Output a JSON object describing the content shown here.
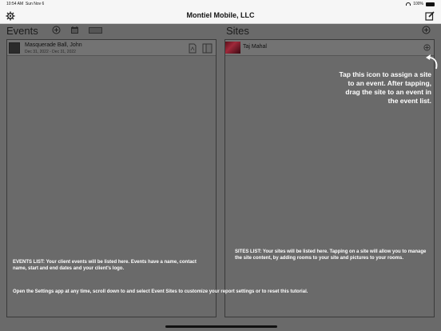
{
  "status_bar": {
    "time": "10:54 AM",
    "date": "Sun Nov 6",
    "battery": "100%"
  },
  "nav": {
    "title": "Montiel Mobile, LLC",
    "left_icon": "gear-icon",
    "right_icon": "compose-icon"
  },
  "events": {
    "header": "Events",
    "items": [
      {
        "title": "Masquerade Ball, John",
        "dates": "Dec 31, 2022 - Dec 31, 2022"
      }
    ],
    "help_label": "EVENTS LIST:",
    "help_text": " Your client events will be listed here. Events have a name, contact name, start and end dates and your client's logo."
  },
  "sites": {
    "header": "Sites",
    "items": [
      {
        "title": "Taj Mahal"
      }
    ],
    "help_label": "SITES LIST:",
    "help_text": " Your sites will be listed here. Tapping on a site will allow you to manage the site content, by adding rooms to your site and pictures to your rooms."
  },
  "tip": "Tap this icon to assign a site to an event. After tapping, drag the site to an event in the event list.",
  "footer_help": "Open the Settings app at any time, scroll down to and select Event Sites to customize your report settings or to reset this tutorial."
}
